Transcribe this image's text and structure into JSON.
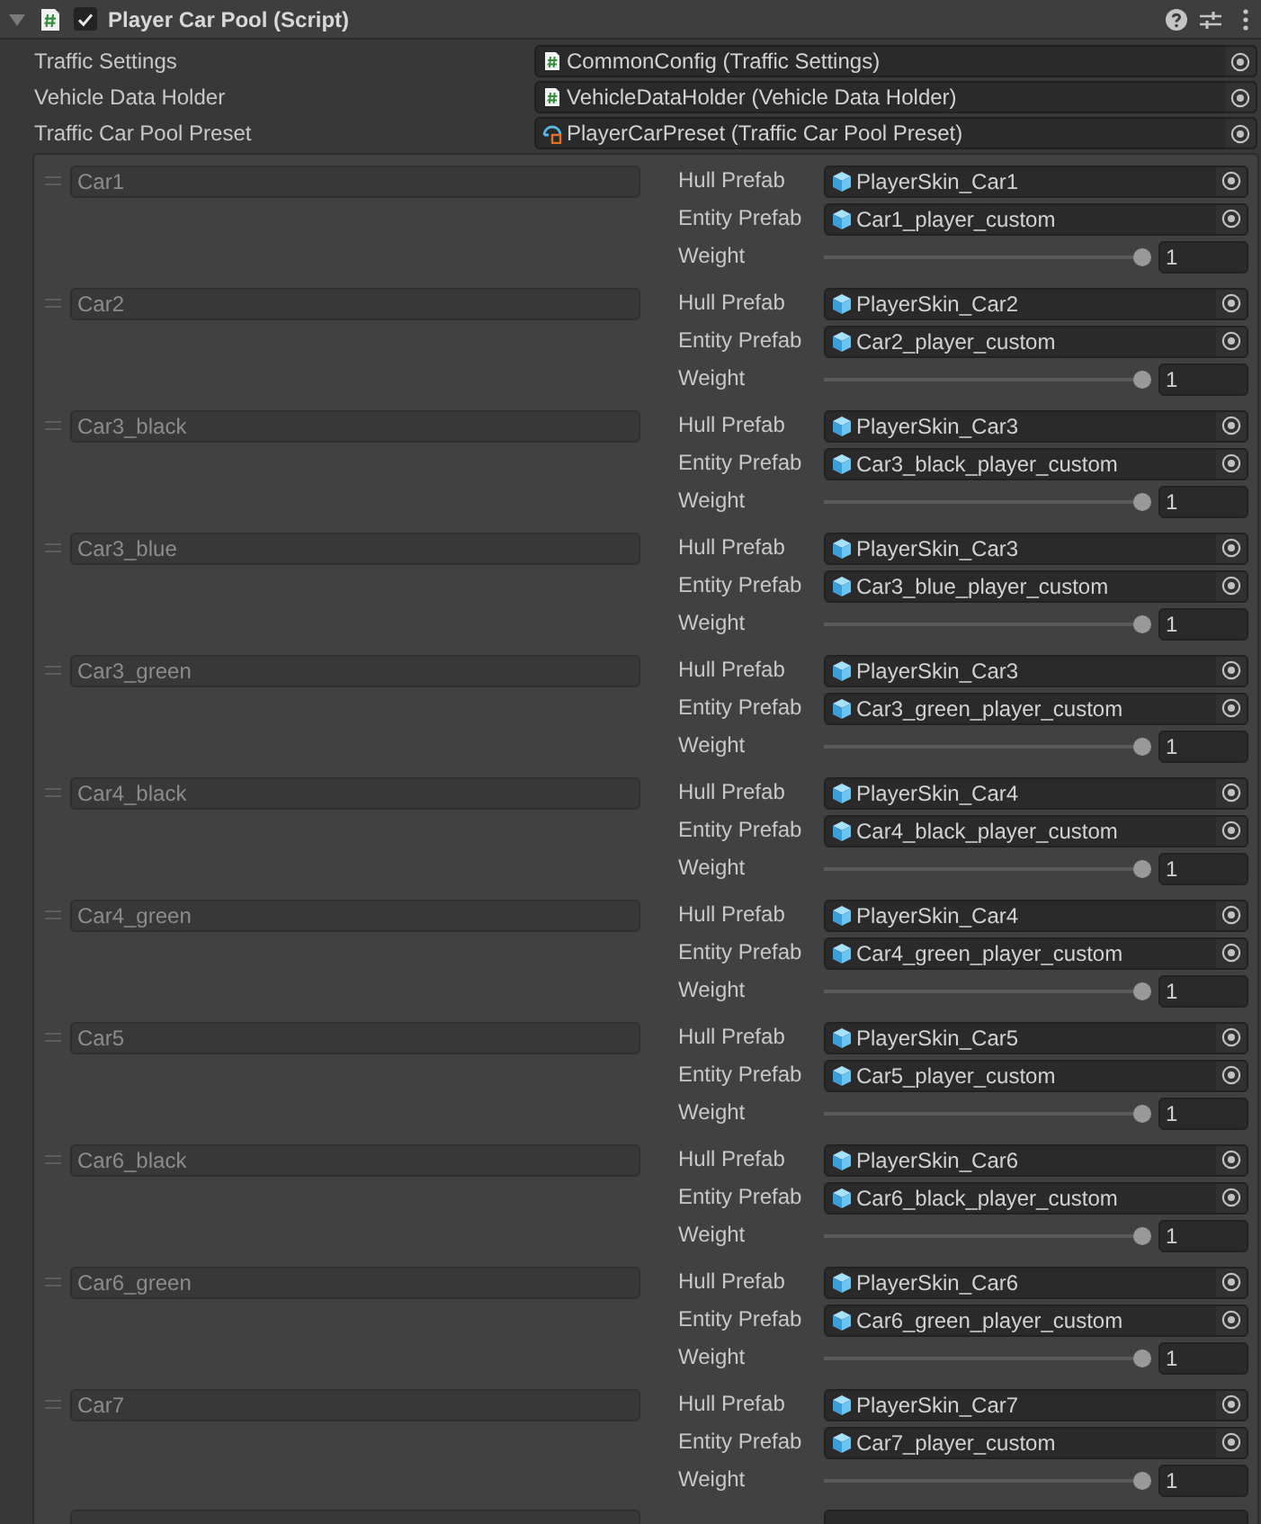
{
  "component": {
    "title": "Player Car Pool (Script)",
    "expanded": true,
    "enabled": true
  },
  "properties": [
    {
      "label": "Traffic Settings",
      "value": "CommonConfig (Traffic Settings)",
      "kind": "script"
    },
    {
      "label": "Vehicle Data Holder",
      "value": "VehicleDataHolder (Vehicle Data Holder)",
      "kind": "script"
    },
    {
      "label": "Traffic Car Pool Preset",
      "value": "PlayerCarPreset (Traffic Car Pool Preset)",
      "kind": "preset"
    }
  ],
  "pool": {
    "elements": [
      {
        "name": "Car1",
        "name_disabled": true,
        "hull_prefab": {
          "label": "Hull Prefab",
          "value": "PlayerSkin_Car1"
        },
        "entity_prefab": {
          "label": "Entity Prefab",
          "value": "Car1_player_custom"
        },
        "weight": {
          "label": "Weight",
          "value": "1",
          "level": 1
        }
      },
      {
        "name": "Car2",
        "name_disabled": true,
        "hull_prefab": {
          "label": "Hull Prefab",
          "value": "PlayerSkin_Car2"
        },
        "entity_prefab": {
          "label": "Entity Prefab",
          "value": "Car2_player_custom"
        },
        "weight": {
          "label": "Weight",
          "value": "1",
          "level": 1
        }
      },
      {
        "name": "Car3_black",
        "name_disabled": true,
        "hull_prefab": {
          "label": "Hull Prefab",
          "value": "PlayerSkin_Car3"
        },
        "entity_prefab": {
          "label": "Entity Prefab",
          "value": "Car3_black_player_custom"
        },
        "weight": {
          "label": "Weight",
          "value": "1",
          "level": 1
        }
      },
      {
        "name": "Car3_blue",
        "name_disabled": true,
        "hull_prefab": {
          "label": "Hull Prefab",
          "value": "PlayerSkin_Car3"
        },
        "entity_prefab": {
          "label": "Entity Prefab",
          "value": "Car3_blue_player_custom"
        },
        "weight": {
          "label": "Weight",
          "value": "1",
          "level": 1
        }
      },
      {
        "name": "Car3_green",
        "name_disabled": true,
        "hull_prefab": {
          "label": "Hull Prefab",
          "value": "PlayerSkin_Car3"
        },
        "entity_prefab": {
          "label": "Entity Prefab",
          "value": "Car3_green_player_custom"
        },
        "weight": {
          "label": "Weight",
          "value": "1",
          "level": 1
        }
      },
      {
        "name": "Car4_black",
        "name_disabled": true,
        "hull_prefab": {
          "label": "Hull Prefab",
          "value": "PlayerSkin_Car4"
        },
        "entity_prefab": {
          "label": "Entity Prefab",
          "value": "Car4_black_player_custom"
        },
        "weight": {
          "label": "Weight",
          "value": "1",
          "level": 1
        }
      },
      {
        "name": "Car4_green",
        "name_disabled": true,
        "hull_prefab": {
          "label": "Hull Prefab",
          "value": "PlayerSkin_Car4"
        },
        "entity_prefab": {
          "label": "Entity Prefab",
          "value": "Car4_green_player_custom"
        },
        "weight": {
          "label": "Weight",
          "value": "1",
          "level": 1
        }
      },
      {
        "name": "Car5",
        "name_disabled": true,
        "hull_prefab": {
          "label": "Hull Prefab",
          "value": "PlayerSkin_Car5"
        },
        "entity_prefab": {
          "label": "Entity Prefab",
          "value": "Car5_player_custom"
        },
        "weight": {
          "label": "Weight",
          "value": "1",
          "level": 1
        }
      },
      {
        "name": "Car6_black",
        "name_disabled": true,
        "hull_prefab": {
          "label": "Hull Prefab",
          "value": "PlayerSkin_Car6"
        },
        "entity_prefab": {
          "label": "Entity Prefab",
          "value": "Car6_black_player_custom"
        },
        "weight": {
          "label": "Weight",
          "value": "1",
          "level": 1
        }
      },
      {
        "name": "Car6_green",
        "name_disabled": true,
        "hull_prefab": {
          "label": "Hull Prefab",
          "value": "PlayerSkin_Car6"
        },
        "entity_prefab": {
          "label": "Entity Prefab",
          "value": "Car6_green_player_custom"
        },
        "weight": {
          "label": "Weight",
          "value": "1",
          "level": 1
        }
      },
      {
        "name": "Car7",
        "name_disabled": true,
        "hull_prefab": {
          "label": "Hull Prefab",
          "value": "PlayerSkin_Car7"
        },
        "entity_prefab": {
          "label": "Entity Prefab",
          "value": "Car7_player_custom"
        },
        "weight": {
          "label": "Weight",
          "value": "1",
          "level": 1
        }
      }
    ],
    "more_below": true
  }
}
